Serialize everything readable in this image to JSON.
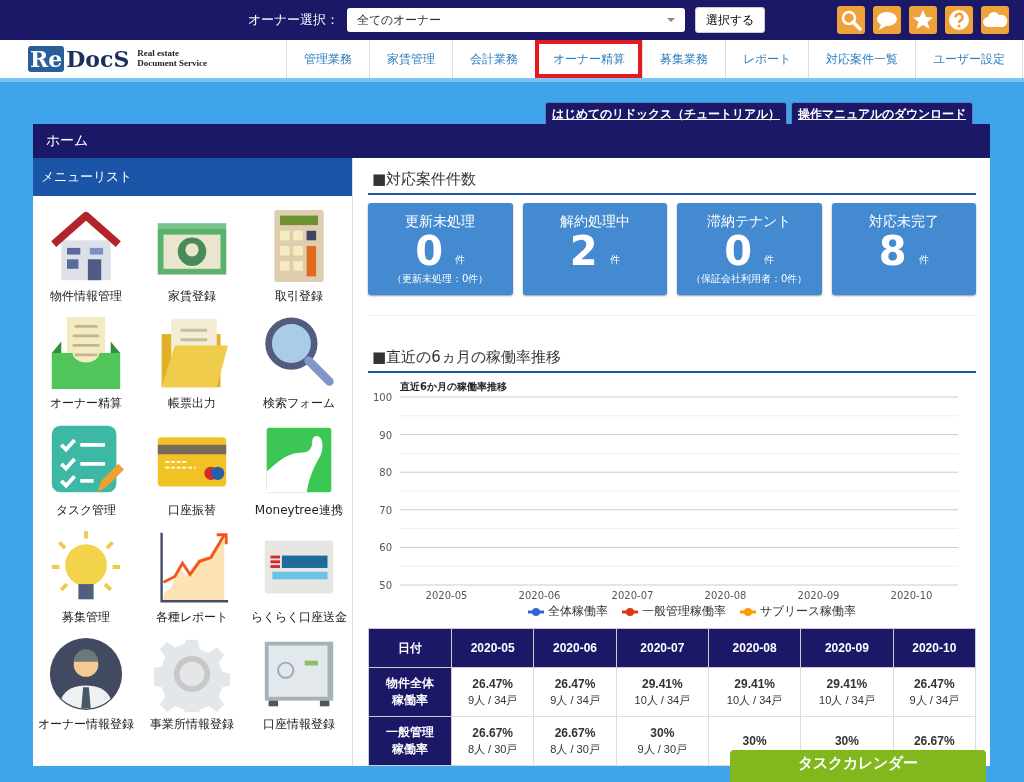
{
  "topbar": {
    "owner_label": "オーナー選択：",
    "owner_select": {
      "value": "全てのオーナー"
    },
    "select_button": "選択する"
  },
  "logo": {
    "mark": "Re",
    "name": "DocS",
    "tagline_1": "Real estate",
    "tagline_2": "Document Service"
  },
  "nav": [
    {
      "label": "管理業務",
      "highlighted": false
    },
    {
      "label": "家賃管理",
      "highlighted": false
    },
    {
      "label": "会計業務",
      "highlighted": false
    },
    {
      "label": "オーナー精算",
      "highlighted": true
    },
    {
      "label": "募集業務",
      "highlighted": false
    },
    {
      "label": "レポート",
      "highlighted": false
    },
    {
      "label": "対応案件一覧",
      "highlighted": false
    },
    {
      "label": "ユーザー設定",
      "highlighted": false
    }
  ],
  "top_links": [
    "はじめてのリドックス（チュートリアル）",
    "操作マニュアルのダウンロード"
  ],
  "page_title": "ホーム",
  "menu": {
    "title": "メニューリスト",
    "items": [
      "物件情報管理",
      "家賃登録",
      "取引登録",
      "オーナー精算",
      "帳票出力",
      "検索フォーム",
      "タスク管理",
      "口座振替",
      "Moneytree連携",
      "募集管理",
      "各種レポート",
      "らくらく口座送金",
      "オーナー情報登録",
      "事業所情報登録",
      "口座情報登録"
    ]
  },
  "cases": {
    "title": "■対応案件件数",
    "cards": [
      {
        "label": "更新未処理",
        "count": "0",
        "unit": "件",
        "note": "（更新未処理：0件）"
      },
      {
        "label": "解約処理中",
        "count": "2",
        "unit": "件"
      },
      {
        "label": "滞納テナント",
        "count": "0",
        "unit": "件",
        "note": "（保証会社利用者：0件）"
      },
      {
        "label": "対応未完了",
        "count": "8",
        "unit": "件"
      }
    ]
  },
  "occupancy": {
    "title": "■直近の6ヵ月の稼働率推移",
    "chart_data": {
      "type": "line",
      "grid": true,
      "title": "直近6か月の稼働率推移",
      "categories": [
        "2020-05",
        "2020-06",
        "2020-07",
        "2020-08",
        "2020-09",
        "2020-10"
      ],
      "ylim": [
        50,
        100
      ],
      "yticks": [
        50,
        60,
        70,
        80,
        90,
        100
      ],
      "series": [
        {
          "name": "全体稼働率",
          "color": "#3366cc",
          "values": [
            null,
            null,
            null,
            null,
            null,
            null
          ]
        },
        {
          "name": "一般管理稼働率",
          "color": "#dc3912",
          "values": [
            null,
            null,
            null,
            null,
            null,
            null
          ]
        },
        {
          "name": "サブリース稼働率",
          "color": "#ff9900",
          "values": [
            null,
            null,
            null,
            null,
            null,
            null
          ]
        }
      ]
    },
    "table": {
      "corner": "日付",
      "columns": [
        "2020-05",
        "2020-06",
        "2020-07",
        "2020-08",
        "2020-09",
        "2020-10"
      ],
      "rows": [
        {
          "label": "物件全体稼働率",
          "cells": [
            {
              "rate": "26.47%",
              "detail": "9人 / 34戸"
            },
            {
              "rate": "26.47%",
              "detail": "9人 / 34戸"
            },
            {
              "rate": "29.41%",
              "detail": "10人 / 34戸"
            },
            {
              "rate": "29.41%",
              "detail": "10人 / 34戸"
            },
            {
              "rate": "29.41%",
              "detail": "10人 / 34戸"
            },
            {
              "rate": "26.47%",
              "detail": "9人 / 34戸"
            }
          ]
        },
        {
          "label": "一般管理稼働率",
          "cells": [
            {
              "rate": "26.67%",
              "detail": "8人 / 30戸"
            },
            {
              "rate": "26.67%",
              "detail": "8人 / 30戸"
            },
            {
              "rate": "30%",
              "detail": "9人 / 30戸"
            },
            {
              "rate": "30%"
            },
            {
              "rate": "30%"
            },
            {
              "rate": "26.67%"
            }
          ]
        }
      ]
    }
  },
  "task_calendar_button": "タスクカレンダー"
}
